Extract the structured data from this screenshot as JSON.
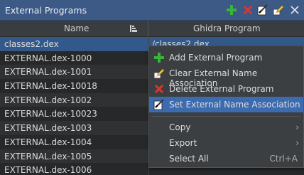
{
  "window": {
    "title": "External Programs",
    "icons": [
      "add-icon",
      "delete-icon",
      "set-association-icon",
      "clear-association-icon",
      "close-icon"
    ]
  },
  "table": {
    "columns": [
      "Name",
      "Ghidra Program"
    ],
    "rows": [
      {
        "name": "classes2.dex",
        "program": "/classes2.dex"
      },
      {
        "name": "EXTERNAL.dex-1000",
        "program": ""
      },
      {
        "name": "EXTERNAL.dex-1001",
        "program": ""
      },
      {
        "name": "EXTERNAL.dex-10018",
        "program": ""
      },
      {
        "name": "EXTERNAL.dex-1002",
        "program": ""
      },
      {
        "name": "EXTERNAL.dex-10023",
        "program": ""
      },
      {
        "name": "EXTERNAL.dex-1003",
        "program": ""
      },
      {
        "name": "EXTERNAL.dex-1004",
        "program": ""
      },
      {
        "name": "EXTERNAL.dex-1005",
        "program": ""
      },
      {
        "name": "EXTERNAL.dex-1006",
        "program": ""
      }
    ]
  },
  "context_menu": {
    "add": "Add External Program",
    "clear": "Clear External Name Association",
    "delete": "Delete External Program",
    "set": "Set External Name Association",
    "copy": "Copy",
    "export": "Export",
    "select_all": "Select All",
    "select_all_shortcut": "Ctrl+A"
  },
  "colors": {
    "accent": "#3d6bb0",
    "title_bar": "#3d5a86",
    "selected_row": "#33598a"
  }
}
